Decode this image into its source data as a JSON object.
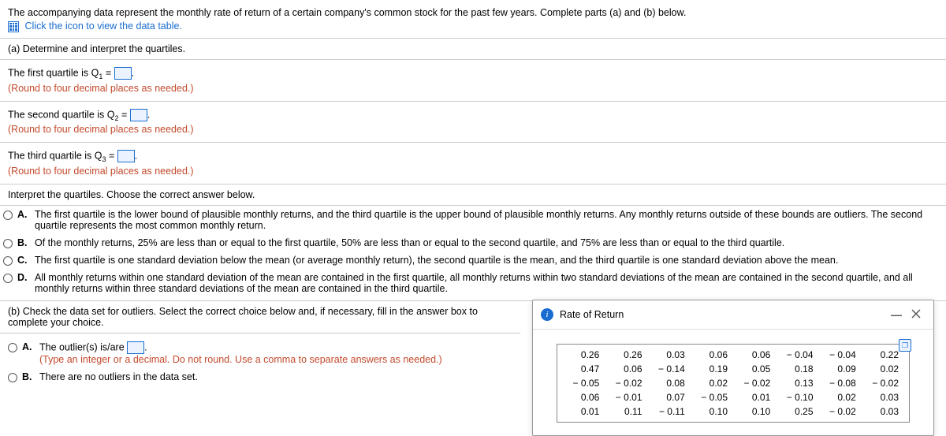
{
  "intro": {
    "text": "The accompanying data represent the monthly rate of return of a certain company's common stock for the past few years. Complete parts (a) and (b) below.",
    "link": "Click the icon to view the data table."
  },
  "part_a": {
    "heading": "(a) Determine and interpret the quartiles.",
    "q1_pre": "The first quartile is Q",
    "q1_sub": "1",
    "q2_pre": "The second quartile is Q",
    "q2_sub": "2",
    "q3_pre": "The third quartile is Q",
    "q3_sub": "3",
    "eq": " = ",
    "period": ".",
    "round": "(Round to four decimal places as needed.)",
    "interpret": "Interpret the quartiles. Choose the correct answer below.",
    "choices": {
      "A": "The first quartile is the lower bound of plausible monthly returns, and the third quartile is the upper bound of plausible monthly returns. Any monthly returns outside of these bounds are outliers. The second quartile represents the most common monthly return.",
      "B": "Of the monthly returns, 25% are less than or equal to the first quartile, 50% are less than or equal to the second quartile, and 75% are less than or equal to the third quartile.",
      "C": "The first quartile is one standard deviation below the mean (or average monthly return), the second quartile is the mean, and the third quartile is one standard deviation above the mean.",
      "D": "All monthly returns within one standard deviation of the mean are contained in the first quartile, all monthly returns within two standard deviations of the mean are contained in the second quartile, and all monthly returns within three standard deviations of the mean are contained in the third quartile."
    }
  },
  "part_b": {
    "heading": "(b) Check the data set for outliers. Select the correct choice below and, if necessary, fill in the answer box to complete your choice.",
    "A_pre": "The outlier(s) is/are ",
    "A_post": ".",
    "A_note": "(Type an integer or a decimal. Do not round. Use a comma to separate answers as needed.)",
    "B": "There are no outliers in the data set."
  },
  "labels": {
    "A": "A.",
    "B": "B.",
    "C": "C.",
    "D": "D."
  },
  "popup": {
    "title": "Rate of Return",
    "info": "i"
  },
  "chart_data": {
    "type": "table",
    "title": "Rate of Return",
    "rows": [
      [
        "0.26",
        "0.26",
        "0.03",
        "0.06",
        "0.06",
        "− 0.04",
        "− 0.04",
        "0.22"
      ],
      [
        "0.47",
        "0.06",
        "− 0.14",
        "0.19",
        "0.05",
        "0.18",
        "0.09",
        "0.02"
      ],
      [
        "− 0.05",
        "− 0.02",
        "0.08",
        "0.02",
        "− 0.02",
        "0.13",
        "− 0.08",
        "− 0.02"
      ],
      [
        "0.06",
        "− 0.01",
        "0.07",
        "− 0.05",
        "0.01",
        "− 0.10",
        "0.02",
        "0.03"
      ],
      [
        "0.01",
        "0.11",
        "− 0.11",
        "0.10",
        "0.10",
        "0.25",
        "− 0.02",
        "0.03"
      ]
    ]
  }
}
